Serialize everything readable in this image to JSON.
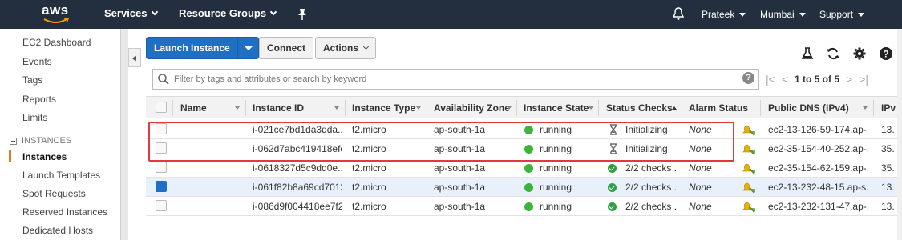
{
  "topnav": {
    "logo": "aws",
    "services": "Services",
    "resource_groups": "Resource Groups",
    "user": "Prateek",
    "region": "Mumbai",
    "support": "Support",
    "bg_color": "#232f3e"
  },
  "sidebar": {
    "items": [
      "EC2 Dashboard",
      "Events",
      "Tags",
      "Reports",
      "Limits"
    ],
    "section": "INSTANCES",
    "section_items": [
      "Instances",
      "Launch Templates",
      "Spot Requests",
      "Reserved Instances",
      "Dedicated Hosts"
    ],
    "active": "Instances",
    "accent": "#e7791f"
  },
  "toolbar": {
    "launch": "Launch Instance",
    "connect": "Connect",
    "actions": "Actions",
    "icons": [
      "flask-icon",
      "refresh-icon",
      "gear-icon",
      "help-icon"
    ]
  },
  "search": {
    "placeholder": "Filter by tags and attributes or search by keyword",
    "pagination": "1 to 5 of 5"
  },
  "table": {
    "headers": [
      "Name",
      "Instance ID",
      "Instance Type",
      "Availability Zone",
      "Instance State",
      "Status Checks",
      "Alarm Status",
      "Public DNS (IPv4)",
      "IPv"
    ],
    "rows": [
      {
        "name": "",
        "id": "i-021ce7bd1da3dda...",
        "type": "t2.micro",
        "az": "ap-south-1a",
        "state": "running",
        "checks": "Initializing",
        "checks_icon": "hourglass-icon",
        "alarm": "None",
        "dns": "ec2-13-126-59-174.ap-...",
        "ip": "13.",
        "selected": false
      },
      {
        "name": "",
        "id": "i-062d7abc419418efc",
        "type": "t2.micro",
        "az": "ap-south-1a",
        "state": "running",
        "checks": "Initializing",
        "checks_icon": "hourglass-icon",
        "alarm": "None",
        "dns": "ec2-35-154-40-252.ap-...",
        "ip": "35.",
        "selected": false
      },
      {
        "name": "",
        "id": "i-0618327d5c9dd0e...",
        "type": "t2.micro",
        "az": "ap-south-1a",
        "state": "running",
        "checks": "2/2 checks ...",
        "checks_icon": "check-circle-icon",
        "alarm": "None",
        "dns": "ec2-35-154-62-159.ap-...",
        "ip": "35.",
        "selected": false
      },
      {
        "name": "",
        "id": "i-061f82b8a69cd7012",
        "type": "t2.micro",
        "az": "ap-south-1a",
        "state": "running",
        "checks": "2/2 checks ...",
        "checks_icon": "check-circle-icon",
        "alarm": "None",
        "dns": "ec2-13-232-48-15.ap-s...",
        "ip": "13.",
        "selected": true
      },
      {
        "name": "",
        "id": "i-086d9f004418ee7f2",
        "type": "t2.micro",
        "az": "ap-south-1a",
        "state": "running",
        "checks": "2/2 checks ...",
        "checks_icon": "check-circle-icon",
        "alarm": "None",
        "dns": "ec2-13-232-131-47.ap-...",
        "ip": "13.",
        "selected": false
      }
    ]
  },
  "colors": {
    "primary": "#1f6fc5",
    "running": "#3cb43c",
    "highlight": "#e0393e"
  }
}
